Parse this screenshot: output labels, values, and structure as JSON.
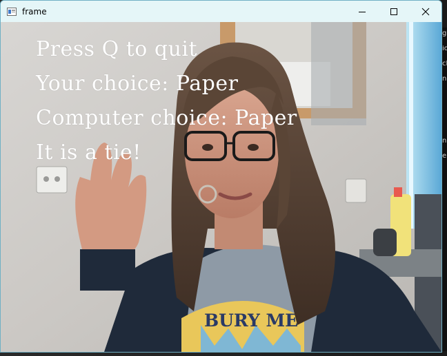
{
  "window": {
    "title": "frame",
    "controls": [
      "minimize",
      "maximize",
      "close"
    ]
  },
  "overlay": {
    "lines": [
      "Press Q to quit",
      "Your choice: Paper",
      "Computer choice: Paper",
      "It is a tie!"
    ]
  },
  "webcam": {
    "shirt_text": "BURY ME"
  },
  "desktop_strip": {
    "glyphs": [
      "g",
      "io",
      "ch",
      "n",
      "n",
      "e"
    ]
  },
  "colors": {
    "titlebar": "#e5f6f8",
    "window_border": "#6fb0c4",
    "overlay_text": "#ffffff"
  },
  "icons": {
    "app": "opencv-window-icon",
    "minimize": "minimize-icon",
    "maximize": "maximize-icon",
    "close": "close-icon"
  }
}
